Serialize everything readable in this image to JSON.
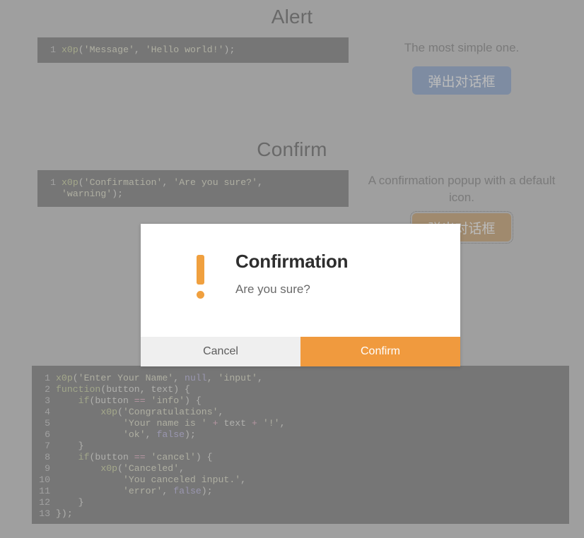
{
  "page": {
    "background_color": "#c4c4c4",
    "accent_color": "#f09a3e"
  },
  "sections": [
    {
      "heading": "Alert",
      "description": "The most simple one.",
      "button_label": "弹出对话框",
      "button_style": "primary",
      "code_lines": [
        {
          "num": "1",
          "parts": [
            {
              "t": "x0p",
              "c": "fn"
            },
            {
              "t": "(",
              "c": "pl"
            },
            {
              "t": "'Message'",
              "c": "str"
            },
            {
              "t": ", ",
              "c": "pl"
            },
            {
              "t": "'Hello world!'",
              "c": "str"
            },
            {
              "t": ");",
              "c": "pl"
            }
          ]
        }
      ]
    },
    {
      "heading": "Confirm",
      "description": "A confirmation popup with a default icon.",
      "button_label": "弹出对话框",
      "button_style": "warning",
      "code_lines": [
        {
          "num": "1",
          "parts": [
            {
              "t": "x0p",
              "c": "fn"
            },
            {
              "t": "(",
              "c": "pl"
            },
            {
              "t": "'Confirmation'",
              "c": "str"
            },
            {
              "t": ", ",
              "c": "pl"
            },
            {
              "t": "'Are you sure?'",
              "c": "str"
            },
            {
              "t": ",",
              "c": "pl"
            }
          ]
        },
        {
          "num": "",
          "parts": [
            {
              "t": "'warning'",
              "c": "str"
            },
            {
              "t": ");",
              "c": "pl"
            }
          ]
        }
      ]
    }
  ],
  "prompt_code": {
    "lines": [
      {
        "num": "1",
        "parts": [
          {
            "t": "x0p",
            "c": "fn"
          },
          {
            "t": "(",
            "c": "pl"
          },
          {
            "t": "'Enter Your Name'",
            "c": "str"
          },
          {
            "t": ", ",
            "c": "pl"
          },
          {
            "t": "null",
            "c": "lit"
          },
          {
            "t": ", ",
            "c": "pl"
          },
          {
            "t": "'input'",
            "c": "str"
          },
          {
            "t": ",",
            "c": "pl"
          }
        ]
      },
      {
        "num": "2",
        "parts": [
          {
            "t": "function",
            "c": "kw"
          },
          {
            "t": "(button, text) {",
            "c": "pl"
          }
        ]
      },
      {
        "num": "3",
        "parts": [
          {
            "t": "    ",
            "c": "pl"
          },
          {
            "t": "if",
            "c": "kw"
          },
          {
            "t": "(button ",
            "c": "pl"
          },
          {
            "t": "==",
            "c": "op"
          },
          {
            "t": " ",
            "c": "pl"
          },
          {
            "t": "'info'",
            "c": "str"
          },
          {
            "t": ") {",
            "c": "pl"
          }
        ]
      },
      {
        "num": "4",
        "parts": [
          {
            "t": "        ",
            "c": "pl"
          },
          {
            "t": "x0p",
            "c": "fn"
          },
          {
            "t": "(",
            "c": "pl"
          },
          {
            "t": "'Congratulations'",
            "c": "str"
          },
          {
            "t": ",",
            "c": "pl"
          }
        ]
      },
      {
        "num": "5",
        "parts": [
          {
            "t": "            ",
            "c": "pl"
          },
          {
            "t": "'Your name is '",
            "c": "str"
          },
          {
            "t": " + ",
            "c": "op"
          },
          {
            "t": "text",
            "c": "pl"
          },
          {
            "t": " + ",
            "c": "op"
          },
          {
            "t": "'!'",
            "c": "str"
          },
          {
            "t": ",",
            "c": "pl"
          }
        ]
      },
      {
        "num": "6",
        "parts": [
          {
            "t": "            ",
            "c": "pl"
          },
          {
            "t": "'ok'",
            "c": "str"
          },
          {
            "t": ", ",
            "c": "pl"
          },
          {
            "t": "false",
            "c": "lit"
          },
          {
            "t": ");",
            "c": "pl"
          }
        ]
      },
      {
        "num": "7",
        "parts": [
          {
            "t": "    }",
            "c": "pl"
          }
        ]
      },
      {
        "num": "8",
        "parts": [
          {
            "t": "    ",
            "c": "pl"
          },
          {
            "t": "if",
            "c": "kw"
          },
          {
            "t": "(button ",
            "c": "pl"
          },
          {
            "t": "==",
            "c": "op"
          },
          {
            "t": " ",
            "c": "pl"
          },
          {
            "t": "'cancel'",
            "c": "str"
          },
          {
            "t": ") {",
            "c": "pl"
          }
        ]
      },
      {
        "num": "9",
        "parts": [
          {
            "t": "        ",
            "c": "pl"
          },
          {
            "t": "x0p",
            "c": "fn"
          },
          {
            "t": "(",
            "c": "pl"
          },
          {
            "t": "'Canceled'",
            "c": "str"
          },
          {
            "t": ",",
            "c": "pl"
          }
        ]
      },
      {
        "num": "10",
        "parts": [
          {
            "t": "            ",
            "c": "pl"
          },
          {
            "t": "'You canceled input.'",
            "c": "str"
          },
          {
            "t": ",",
            "c": "pl"
          }
        ]
      },
      {
        "num": "11",
        "parts": [
          {
            "t": "            ",
            "c": "pl"
          },
          {
            "t": "'error'",
            "c": "str"
          },
          {
            "t": ", ",
            "c": "pl"
          },
          {
            "t": "false",
            "c": "lit"
          },
          {
            "t": ");",
            "c": "pl"
          }
        ]
      },
      {
        "num": "12",
        "parts": [
          {
            "t": "    }",
            "c": "pl"
          }
        ]
      },
      {
        "num": "13",
        "parts": [
          {
            "t": "});",
            "c": "pl"
          }
        ]
      }
    ]
  },
  "modal": {
    "title": "Confirmation",
    "message": "Are you sure?",
    "icon": "warning-exclamation-icon",
    "cancel_label": "Cancel",
    "confirm_label": "Confirm",
    "confirm_color": "#f09a3e",
    "cancel_color": "#efefef"
  }
}
